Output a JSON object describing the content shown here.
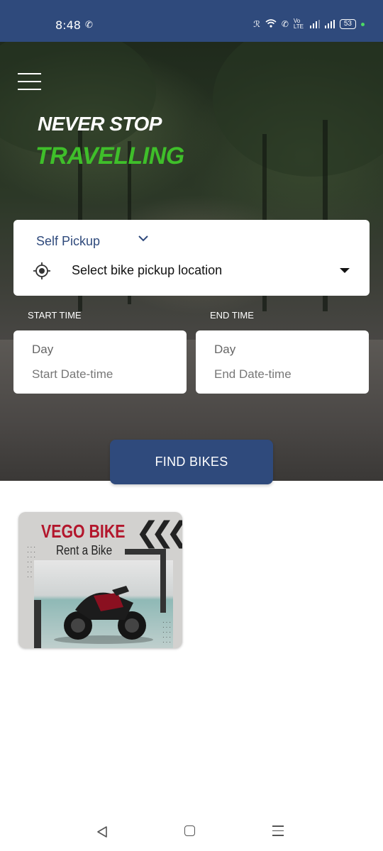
{
  "status_bar": {
    "time": "8:48",
    "battery": "53",
    "volte": "Vo LTE"
  },
  "hero": {
    "tagline_line1": "NEVER STOP",
    "tagline_line2": "TRAVELLING"
  },
  "booking": {
    "pickup_mode": "Self Pickup",
    "location_placeholder": "Select bike pickup location",
    "start_label": "START TIME",
    "end_label": "END TIME",
    "start_day": "Day",
    "start_datetime": "Start Date-time",
    "end_day": "Day",
    "end_datetime": "End Date-time",
    "find_button": "FIND BIKES"
  },
  "promo": {
    "title": "VEGO BIKE",
    "subtitle": "Rent a Bike"
  },
  "colors": {
    "primary": "#2f4a7c",
    "accent_green": "#3fbf2a",
    "promo_red": "#b3162c"
  }
}
